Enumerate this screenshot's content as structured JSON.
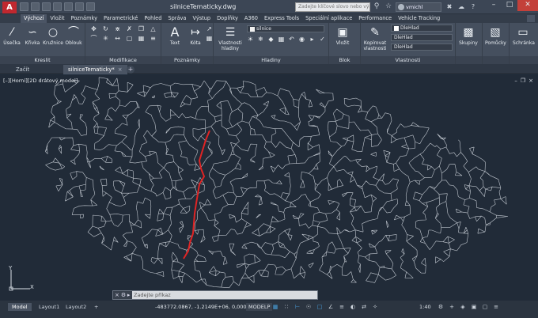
{
  "app": {
    "logo": "A",
    "title": "silniceTematicky.dwg"
  },
  "header": {
    "search_placeholder": "Zadejte klíčové slovo nebo výraz",
    "user": "vmichl"
  },
  "ribbon_tabs": [
    "Výchozí",
    "Vložit",
    "Poznámky",
    "Parametrické",
    "Pohled",
    "Správa",
    "Výstup",
    "Doplňky",
    "A360",
    "Express Tools",
    "Speciální aplikace",
    "Performance",
    "Vehicle Tracking"
  ],
  "ribbon": {
    "draw": {
      "title": "Kreslit",
      "buttons": [
        "Úsečka",
        "Křivka",
        "Kružnice",
        "Oblouk"
      ]
    },
    "modify": {
      "title": "Modifikace"
    },
    "annotation": {
      "title": "Poznámky",
      "buttons": [
        "Text",
        "Kóta"
      ]
    },
    "layers": {
      "title": "Hladiny",
      "button": "Vlastnosti hladiny",
      "layer_name": "silnice"
    },
    "block": {
      "title": "Blok",
      "button": "Vložit"
    },
    "properties": {
      "title": "Vlastnosti",
      "button": "Kopírovat vlastnosti",
      "color": "DleHlad",
      "linetype": "DleHlad",
      "lineweight": "DleHlad"
    },
    "groups": {
      "button": "Skupiny"
    },
    "utilities": {
      "button": "Pomůcky"
    },
    "clipboard": {
      "button": "Schránka"
    }
  },
  "file_tabs": [
    {
      "label": "Začít"
    },
    {
      "label": "silniceTematicky*"
    }
  ],
  "viewport": {
    "label": "[–][Horní][2D drátový model]",
    "ucs_x": "X",
    "ucs_y": "Y"
  },
  "command_line": {
    "prompt": "Zadejte příkaz"
  },
  "status": {
    "layout_tabs": [
      "Model",
      "Layout1",
      "Layout2"
    ],
    "coordinates": "-483772.0867, -1.2149E+06, 0,0000",
    "model": "MODELP",
    "scale": "1:40"
  },
  "colors": {
    "route": "#e02424",
    "network": "#dfe5ec",
    "background": "#212b38"
  }
}
